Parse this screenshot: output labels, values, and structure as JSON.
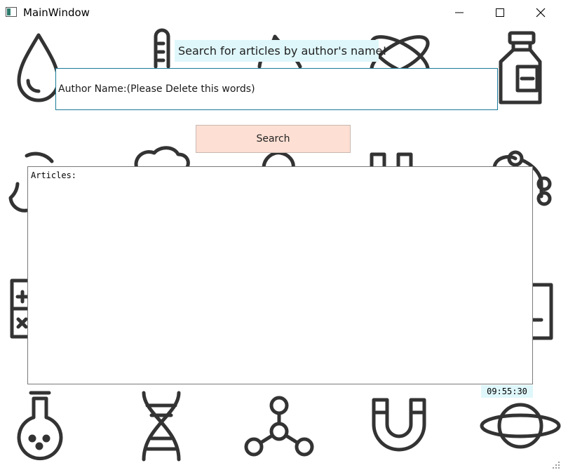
{
  "window": {
    "title": "MainWindow",
    "icon": "app-window-icon"
  },
  "controls": {
    "minimize": "minimize-icon",
    "maximize": "maximize-icon",
    "close": "close-icon"
  },
  "heading": {
    "text": "Search for articles by author's name!"
  },
  "author_input": {
    "value": "Author Name:(Please Delete this words)"
  },
  "search_button": {
    "label": "Search"
  },
  "articles": {
    "label": "Articles:"
  },
  "clock": {
    "time": "09:55:30"
  },
  "colors": {
    "label_bg": "#dff7fb",
    "button_bg": "#fddfd3",
    "input_border": "#1a7a9a",
    "icon_stroke": "#333333"
  },
  "background_icons": [
    "drop-icon",
    "thermometer-icon",
    "flame-icon",
    "atom-icon",
    "bottle-icon",
    "biohazard-icon",
    "brain-icon",
    "bulb-icon",
    "test-tubes-icon",
    "molecule-icon",
    "calculator-icon",
    "clipboard-icon",
    "flask-icon",
    "dna-icon",
    "network-icon",
    "magnet-icon",
    "planet-icon"
  ]
}
